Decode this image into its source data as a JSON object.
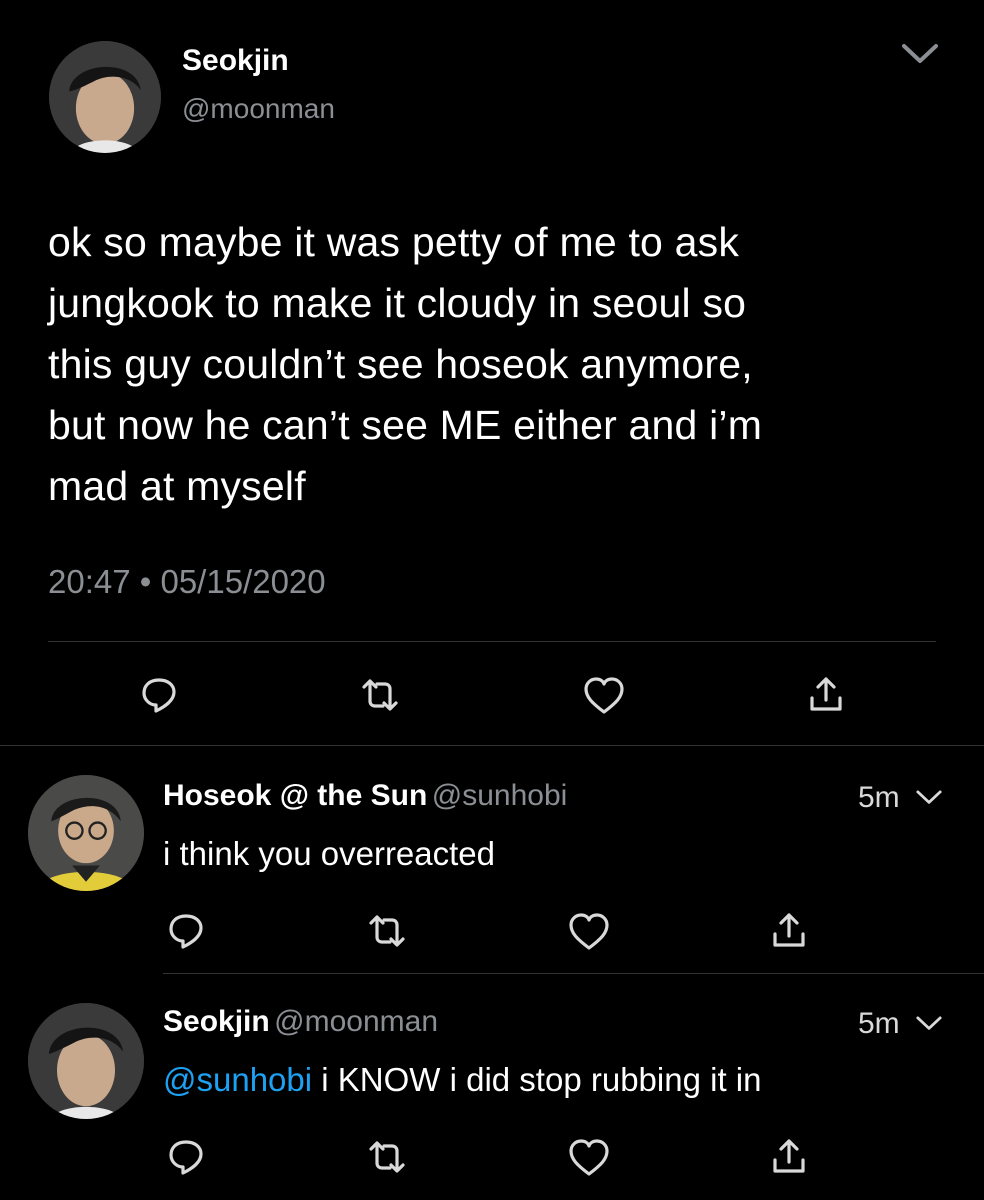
{
  "main_tweet": {
    "author_name": "Seokjin",
    "handle": "@moonman",
    "lines": [
      "ok so maybe it was petty of me to ask",
      "jungkook to make it cloudy in seoul so",
      "this guy couldn’t see hoseok anymore,",
      "but now he can’t see ME either and i’m",
      "mad at myself"
    ],
    "timestamp": "20:47 • 05/15/2020",
    "menu_icon": "chevron-down-icon"
  },
  "replies": [
    {
      "author_name": "Hoseok @ the Sun",
      "handle": "@sunhobi",
      "time": "5m",
      "mention": "",
      "text": "i think you overreacted"
    },
    {
      "author_name": "Seokjin",
      "handle": "@moonman",
      "time": "5m",
      "mention": "@sunhobi",
      "text": " i KNOW i did stop rubbing it in"
    }
  ],
  "action_icons": [
    "reply-icon",
    "retweet-icon",
    "like-icon",
    "share-icon"
  ],
  "colors": {
    "background": "#000000",
    "text": "#ffffff",
    "secondary_text": "#8b8f94",
    "mention": "#1da1f2",
    "divider": "#2f3336"
  }
}
